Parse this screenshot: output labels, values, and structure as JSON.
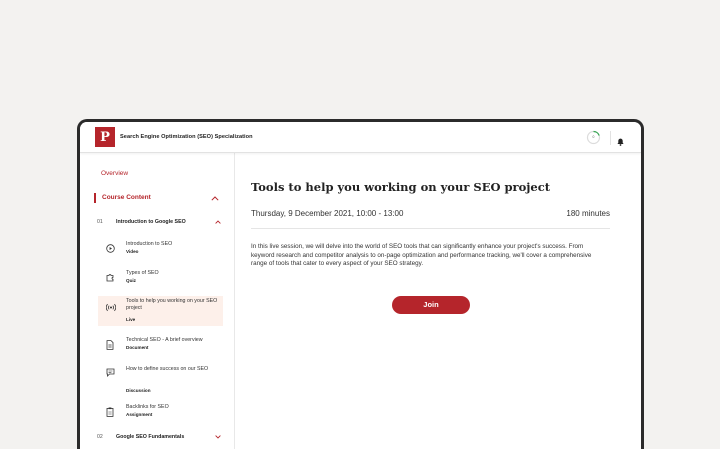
{
  "header": {
    "app_title": "Search Engine Optimization (SEO) Specialization",
    "progress_text": "0"
  },
  "sidebar": {
    "overview_label": "Overview",
    "course_content_label": "Course Content",
    "modules": [
      {
        "number": "01",
        "title": "Introduction to Google SEO",
        "expanded": true
      },
      {
        "number": "02",
        "title": "Google SEO Fundamentals",
        "expanded": false
      }
    ],
    "lessons": [
      {
        "title": "Introduction to SEO",
        "type": "Video",
        "icon": "play-circle-icon"
      },
      {
        "title": "Types of SEO",
        "type": "Quiz",
        "icon": "puzzle-icon"
      },
      {
        "title": "Tools to help you working on your SEO project",
        "type": "Live",
        "icon": "broadcast-icon",
        "active": true
      },
      {
        "title": "Technical SEO - A brief overview",
        "type": "Document",
        "icon": "document-icon"
      },
      {
        "title": "How to define success on our SEO",
        "type": "Discussion",
        "icon": "chat-icon"
      },
      {
        "title": "Backlinks for SEO",
        "type": "Assignment",
        "icon": "clipboard-icon"
      }
    ]
  },
  "main": {
    "title": "Tools to help you working on your SEO project",
    "date": "Thursday, 9 December 2021, 10:00 - 13:00",
    "duration": "180 minutes",
    "description": "In this live session, we will delve into the world of SEO tools that can significantly enhance your project's success. From keyword research and competitor analysis to on-page optimization and performance tracking, we'll cover a comprehensive range of tools that cater to every aspect of your SEO strategy.",
    "join_label": "Join"
  },
  "colors": {
    "accent": "#b5252b",
    "active_bg": "#fdf0ea"
  }
}
